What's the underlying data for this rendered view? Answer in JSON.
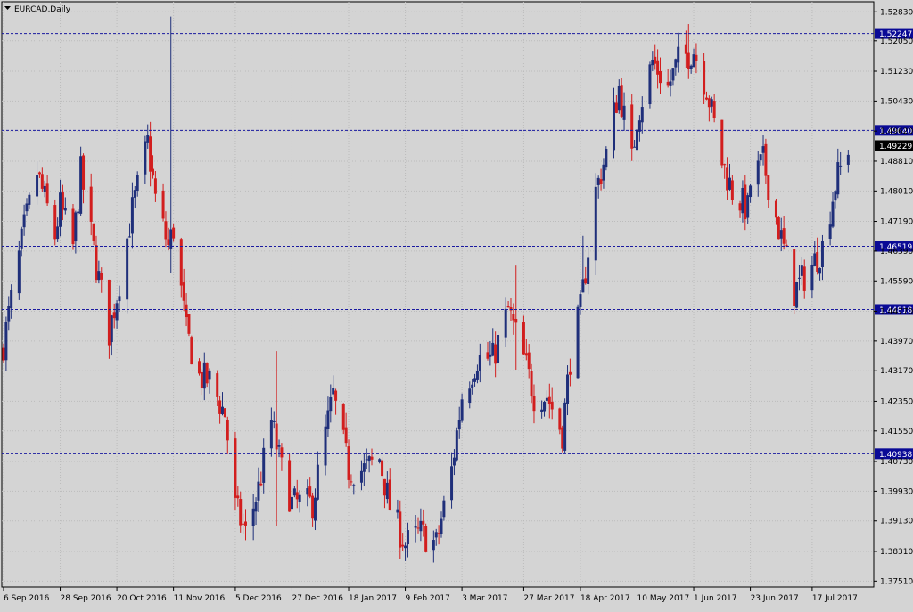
{
  "window": {
    "symbol_label": "EURCAD,Daily"
  },
  "colors": {
    "background": "#d4d4d4",
    "grid": "#bcbcbc",
    "bull": "#1f2f7a",
    "bear": "#d21e1e",
    "hline": "#1a1aa0",
    "label_bg": "#0a0a96",
    "current_bg": "#000000",
    "axis_text": "#000000"
  },
  "chart_data": {
    "type": "candlestick",
    "title": "EURCAD,Daily",
    "ylim": [
      1.3735,
      1.531
    ],
    "y_ticks": [
      "1.52830",
      "1.52050",
      "1.51230",
      "1.50430",
      "1.49620",
      "1.48810",
      "1.48010",
      "1.47190",
      "1.46390",
      "1.45590",
      "1.44770",
      "1.43970",
      "1.43170",
      "1.42350",
      "1.41550",
      "1.40730",
      "1.39930",
      "1.39130",
      "1.38310",
      "1.37510"
    ],
    "x_ticks": [
      "6 Sep 2016",
      "28 Sep 2016",
      "20 Oct 2016",
      "11 Nov 2016",
      "5 Dec 2016",
      "27 Dec 2016",
      "18 Jan 2017",
      "9 Feb 2017",
      "3 Mar 2017",
      "27 Mar 2017",
      "18 Apr 2017",
      "10 May 2017",
      "1 Jun 2017",
      "23 Jun 2017",
      "17 Jul 2017"
    ],
    "horizontal_levels": [
      "1.52247",
      "1.49640",
      "1.46519",
      "1.44818",
      "1.40938"
    ],
    "current_price": "1.49229",
    "grid": true,
    "close_path": [
      [
        "6 Sep 2016",
        1.439
      ],
      [
        "14 Sep 2016",
        1.47
      ],
      [
        "19 Sep 2016",
        1.485
      ],
      [
        "26 Sep 2016",
        1.468
      ],
      [
        "28 Sep 2016",
        1.476
      ],
      [
        "3 Oct 2016",
        1.465
      ],
      [
        "6 Oct 2016",
        1.485
      ],
      [
        "12 Oct 2016",
        1.46
      ],
      [
        "17 Oct 2016",
        1.442
      ],
      [
        "20 Oct 2016",
        1.452
      ],
      [
        "26 Oct 2016",
        1.475
      ],
      [
        "1 Nov 2016",
        1.493
      ],
      [
        "4 Nov 2016",
        1.478
      ],
      [
        "9 Nov 2016",
        1.465
      ],
      [
        "11 Nov 2016",
        1.47
      ],
      [
        "16 Nov 2016",
        1.442
      ],
      [
        "21 Nov 2016",
        1.43
      ],
      [
        "25 Nov 2016",
        1.429
      ],
      [
        "1 Dec 2016",
        1.42
      ],
      [
        "5 Dec 2016",
        1.395
      ],
      [
        "9 Dec 2016",
        1.388
      ],
      [
        "14 Dec 2016",
        1.4
      ],
      [
        "19 Dec 2016",
        1.418
      ],
      [
        "23 Dec 2016",
        1.405
      ],
      [
        "27 Dec 2016",
        1.396
      ],
      [
        "4 Jan 2017",
        1.396
      ],
      [
        "9 Jan 2017",
        1.415
      ],
      [
        "12 Jan 2017",
        1.425
      ],
      [
        "18 Jan 2017",
        1.405
      ],
      [
        "24 Jan 2017",
        1.405
      ],
      [
        "30 Jan 2017",
        1.408
      ],
      [
        "3 Feb 2017",
        1.395
      ],
      [
        "9 Feb 2017",
        1.385
      ],
      [
        "15 Feb 2017",
        1.388
      ],
      [
        "21 Feb 2017",
        1.385
      ],
      [
        "27 Feb 2017",
        1.405
      ],
      [
        "3 Mar 2017",
        1.425
      ],
      [
        "9 Mar 2017",
        1.435
      ],
      [
        "15 Mar 2017",
        1.435
      ],
      [
        "21 Mar 2017",
        1.448
      ],
      [
        "27 Mar 2017",
        1.435
      ],
      [
        "31 Mar 2017",
        1.425
      ],
      [
        "5 Apr 2017",
        1.425
      ],
      [
        "11 Apr 2017",
        1.415
      ],
      [
        "14 Apr 2017",
        1.435
      ],
      [
        "18 Apr 2017",
        1.448
      ],
      [
        "24 Apr 2017",
        1.48
      ],
      [
        "28 Apr 2017",
        1.49
      ],
      [
        "3 May 2017",
        1.508
      ],
      [
        "8 May 2017",
        1.488
      ],
      [
        "10 May 2017",
        1.5
      ],
      [
        "16 May 2017",
        1.515
      ],
      [
        "22 May 2017",
        1.508
      ],
      [
        "26 May 2017",
        1.515
      ],
      [
        "1 Jun 2017",
        1.518
      ],
      [
        "6 Jun 2017",
        1.508
      ],
      [
        "12 Jun 2017",
        1.488
      ],
      [
        "16 Jun 2017",
        1.48
      ],
      [
        "22 Jun 2017",
        1.475
      ],
      [
        "23 Jun 2017",
        1.482
      ],
      [
        "28 Jun 2017",
        1.488
      ],
      [
        "4 Jul 2017",
        1.47
      ],
      [
        "10 Jul 2017",
        1.453
      ],
      [
        "13 Jul 2017",
        1.456
      ],
      [
        "17 Jul 2017",
        1.46
      ],
      [
        "21 Jul 2017",
        1.465
      ],
      [
        "26 Jul 2017",
        1.482
      ],
      [
        "31 Jul 2017",
        1.492
      ]
    ],
    "spikes": [
      [
        "10 Nov 2016",
        1.527,
        1.458
      ],
      [
        "21 Dec 2016",
        1.437,
        1.39
      ],
      [
        "24 Mar 2017",
        1.46,
        1.432
      ],
      [
        "19 Apr 2017",
        1.468,
        1.458
      ],
      [
        "30 May 2017",
        1.525,
        1.512
      ]
    ]
  }
}
